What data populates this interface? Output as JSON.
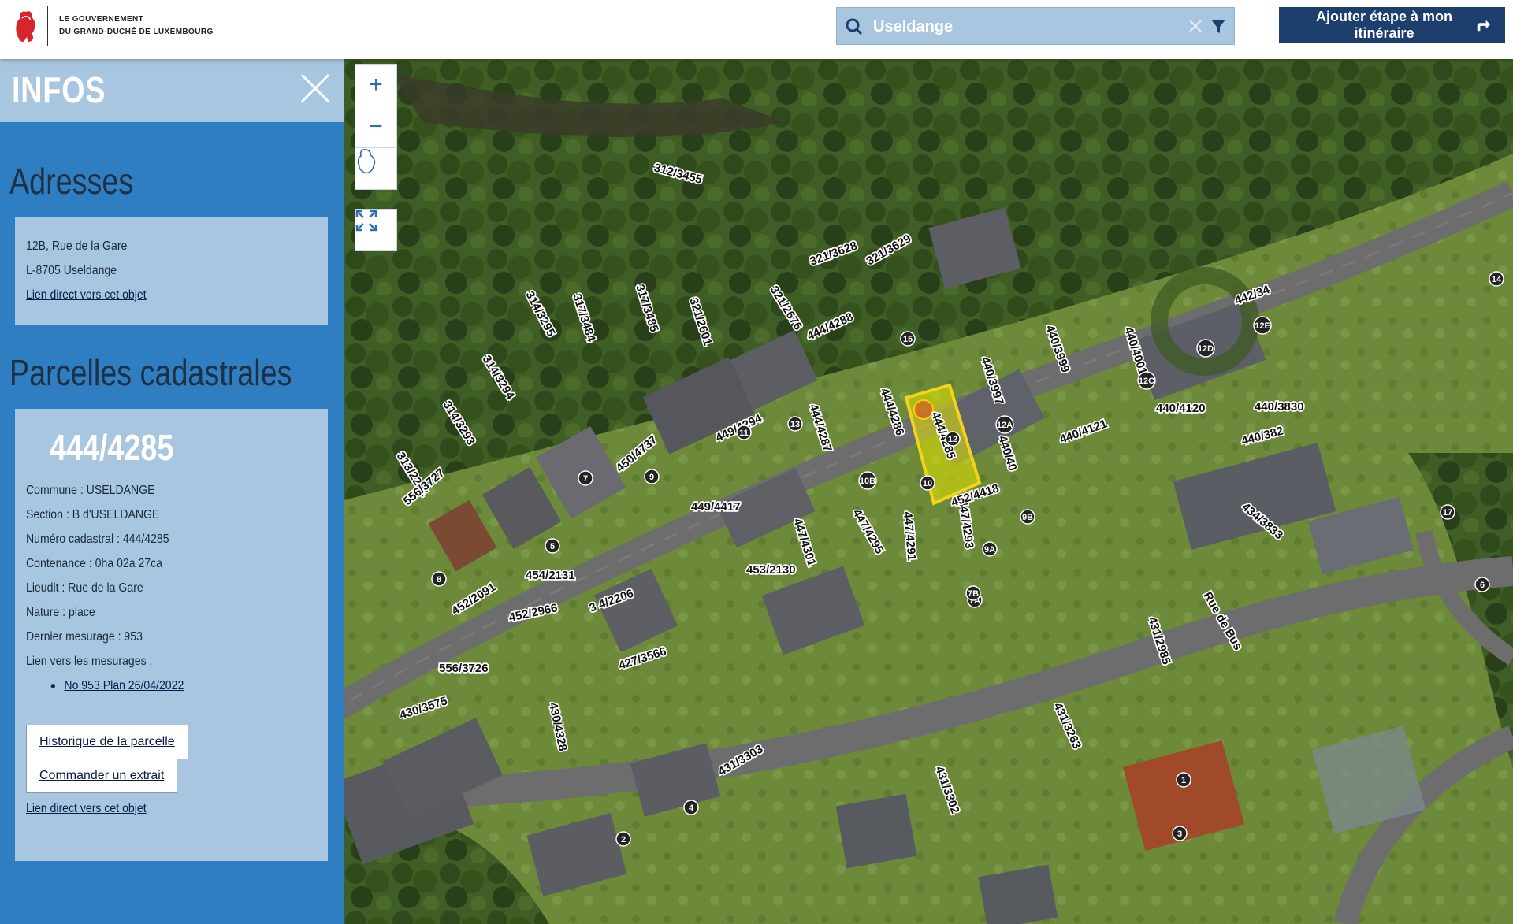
{
  "header": {
    "logo_line1": "LE GOUVERNEMENT",
    "logo_line2": "DU GRAND-DUCHÉ DE LUXEMBOURG",
    "search_value": "Useldange",
    "route_button": "Ajouter étape à mon itinéraire"
  },
  "colors": {
    "accent": "#1d3f6e",
    "panel": "#2f7ec1",
    "panel_light": "#a9c6e0",
    "highlight": "#e6e600"
  },
  "sidebar": {
    "title": "INFOS",
    "addresses_title": "Adresses",
    "address": {
      "line1": "12B, Rue de la Gare",
      "line2": "L-8705 Useldange",
      "link": "Lien direct vers cet objet"
    },
    "parcels_title": "Parcelles cadastrales",
    "parcel": {
      "id": "444/4285",
      "commune": "Commune : USELDANGE",
      "section": "Section : B d'USELDANGE",
      "numero": "Numéro cadastral : 444/4285",
      "contenance": "Contenance : 0ha 02a 27ca",
      "lieudit": "Lieudit : Rue de la Gare",
      "nature": "Nature : place",
      "mesurage": "Dernier mesurage : 953",
      "mesurages_label": "Lien vers les mesurages :",
      "mesurage_link": "No 953 Plan 26/04/2022",
      "btn_history": "Historique de la parcelle",
      "btn_extract": "Commander un extrait",
      "link": "Lien direct vers cet objet"
    }
  },
  "map": {
    "controls": {
      "zoom_in": "+",
      "zoom_out": "−"
    },
    "parcel_labels": [
      "312/3455",
      "317/3485",
      "317/3484",
      "314/3295",
      "314/3294",
      "314/3293",
      "313/2201",
      "321/2601",
      "321/2676",
      "321/3628",
      "321/3629",
      "444/4288",
      "444/4286",
      "444/4287",
      "444/4285",
      "440/3997",
      "440/3999",
      "440/4001",
      "442/34",
      "440/4121",
      "440/4120",
      "440/3830",
      "440/382",
      "440/40",
      "434/3833",
      "449/4294",
      "450/4737",
      "449/4417",
      "447/4301",
      "447/4295",
      "447/4291",
      "447/4293",
      "452/4418",
      "453/2130",
      "454/2131",
      "452/2091",
      "452/2966",
      "3 4/2206",
      "556/3727",
      "556/3726",
      "430/3575",
      "430/4328",
      "427/3566",
      "431/3303",
      "431/3302",
      "431/3263",
      "431/2985",
      "Rue de Bus"
    ],
    "house_numbers": [
      "15",
      "14",
      "13",
      "12D",
      "12E",
      "12C",
      "12A",
      "12",
      "11",
      "10B",
      "10",
      "9",
      "9A",
      "9B",
      "8",
      "7",
      "7A",
      "7B",
      "6",
      "5",
      "4",
      "3",
      "2",
      "1",
      "17"
    ]
  }
}
